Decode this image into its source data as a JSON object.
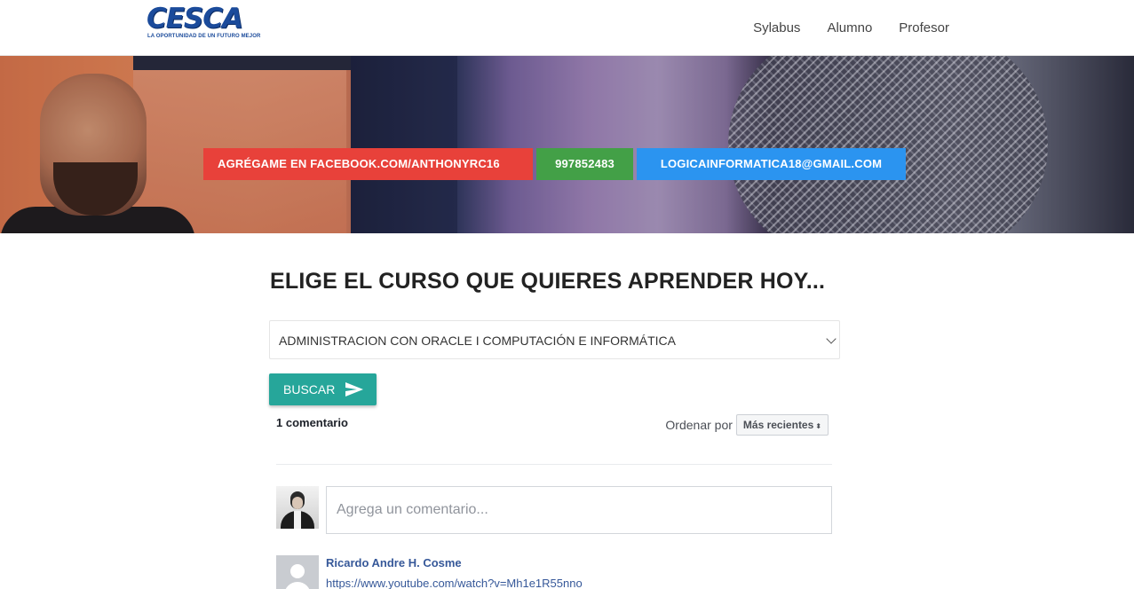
{
  "navbar": {
    "logo_text": "CESCA",
    "logo_tagline": "LA OPORTUNIDAD DE UN FUTURO MEJOR",
    "links": [
      "Sylabus",
      "Alumno",
      "Profesor"
    ]
  },
  "hero": {
    "facebook_prefix": "AGRÉGAME EN ",
    "facebook_handle": "FACEBOOK.COM/ANTHONYRC16",
    "phone": "997852483",
    "email": "LOGICAINFORMATICA18@GMAIL.COM",
    "colors": {
      "facebook": "#e8413a",
      "phone": "#43a047",
      "email": "#2b94f0"
    }
  },
  "main": {
    "title": "ELIGE EL CURSO QUE QUIERES APRENDER HOY...",
    "course_selected": "ADMINISTRACION CON ORACLE I COMPUTACIÓN E INFORMÁTICA",
    "search_label": "BUSCAR",
    "search_color": "#26a69a"
  },
  "comments": {
    "count_label": "1 comentario",
    "sort_label": "Ordenar por",
    "sort_value": "Más recientes",
    "input_placeholder": "Agrega un comentario...",
    "items": [
      {
        "author": "Ricardo Andre H. Cosme",
        "text": "https://www.youtube.com/watch?v=Mh1e1R55nno"
      }
    ]
  }
}
